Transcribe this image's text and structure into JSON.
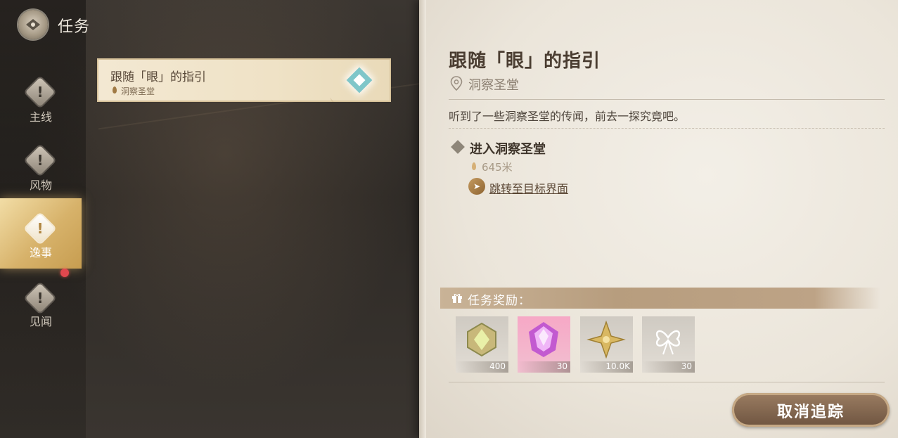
{
  "header": {
    "title": "任务"
  },
  "nav": [
    {
      "label": "主线",
      "active": false
    },
    {
      "label": "风物",
      "active": false
    },
    {
      "label": "逸事",
      "active": true
    },
    {
      "label": "见闻",
      "active": false
    }
  ],
  "quest_list": [
    {
      "title": "跟随「眼」的指引",
      "location": "洞察圣堂",
      "tracked": true
    }
  ],
  "detail": {
    "title": "跟随「眼」的指引",
    "location": "洞察圣堂",
    "description": "听到了一些洞察圣堂的传闻，前去一探究竟吧。",
    "objective": {
      "title": "进入洞察圣堂",
      "distance": "645米",
      "jump_label": "跳转至目标界面"
    },
    "rewards_label": "任务奖励：",
    "rewards": [
      {
        "icon": "adventure-exp-icon",
        "count": "400"
      },
      {
        "icon": "primogem-icon",
        "count": "30"
      },
      {
        "icon": "mora-icon",
        "count": "10.0K"
      },
      {
        "icon": "companionship-exp-icon",
        "count": "30"
      }
    ],
    "cancel_label": "取消追踪"
  },
  "colors": {
    "nav_active": "#d7b26a",
    "panel_bg": "#ebe5da",
    "button": "#6e5440",
    "reward_primogem_bg": "#f6a8c6"
  }
}
